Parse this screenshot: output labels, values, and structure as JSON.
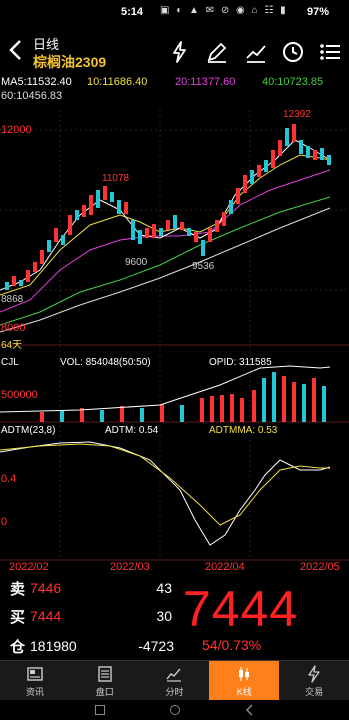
{
  "status": {
    "time": "5:14",
    "battery": "97%",
    "icons": "▣ ◐ ▲ ✉ ⊘ ◉ ⌂ ☷ ▮"
  },
  "nav": {
    "title": "日线",
    "subtitle": "棕榈油2309",
    "tools": [
      "lightning-icon",
      "pen-icon",
      "trend-icon",
      "clock-icon",
      "menu-icon"
    ]
  },
  "ma": {
    "ma5": "MA5:11532.40",
    "ma10": "10:11686.40",
    "ma20": "20:11377.60",
    "ma40": "40:10723.85",
    "ma60": "60:10456.83"
  },
  "colors": {
    "ma5": "#ffffff",
    "ma10": "#f0e040",
    "ma20": "#e040e0",
    "ma40": "#40d040",
    "ma60": "#dddddd",
    "up": "#ff3333",
    "down": "#22c7d6",
    "accent": "#ff7f1a"
  },
  "price_axis": {
    "top": "12000",
    "bottom": "8000",
    "hi_label": "12392",
    "lo_label_1": "11078",
    "lo_label_2": "9600",
    "lo_label_3": "9536",
    "left_label": "8868",
    "days": "64天"
  },
  "volume_panel": {
    "name": "CJL",
    "vol": "VOL: 854048(50:50)",
    "opid": "OPID: 311585",
    "axis": "500000"
  },
  "adtm_panel": {
    "name": "ADTM(23,8)",
    "adtm": "ADTM: 0.54",
    "adtmma": "ADTMMA: 0.53",
    "axis_top": "0.4",
    "axis_bottom": "0"
  },
  "dates": [
    "2022/02",
    "2022/03",
    "2022/04",
    "2022/05"
  ],
  "quote": {
    "sell_label": "卖",
    "sell_price": "7446",
    "sell_qty": "43",
    "buy_label": "买",
    "buy_price": "7444",
    "buy_qty": "30",
    "oi_label": "仓",
    "oi_value": "181980",
    "oi_change": "-4723",
    "last_price": "7444",
    "change": "54/0.73%"
  },
  "tabs": [
    {
      "label": "资讯",
      "icon": "news-icon",
      "active": false
    },
    {
      "label": "盘口",
      "icon": "orderbook-icon",
      "active": false
    },
    {
      "label": "分时",
      "icon": "timeshare-icon",
      "active": false
    },
    {
      "label": "K线",
      "icon": "kline-icon",
      "active": true
    },
    {
      "label": "交易",
      "icon": "trade-icon",
      "active": false
    }
  ]
}
